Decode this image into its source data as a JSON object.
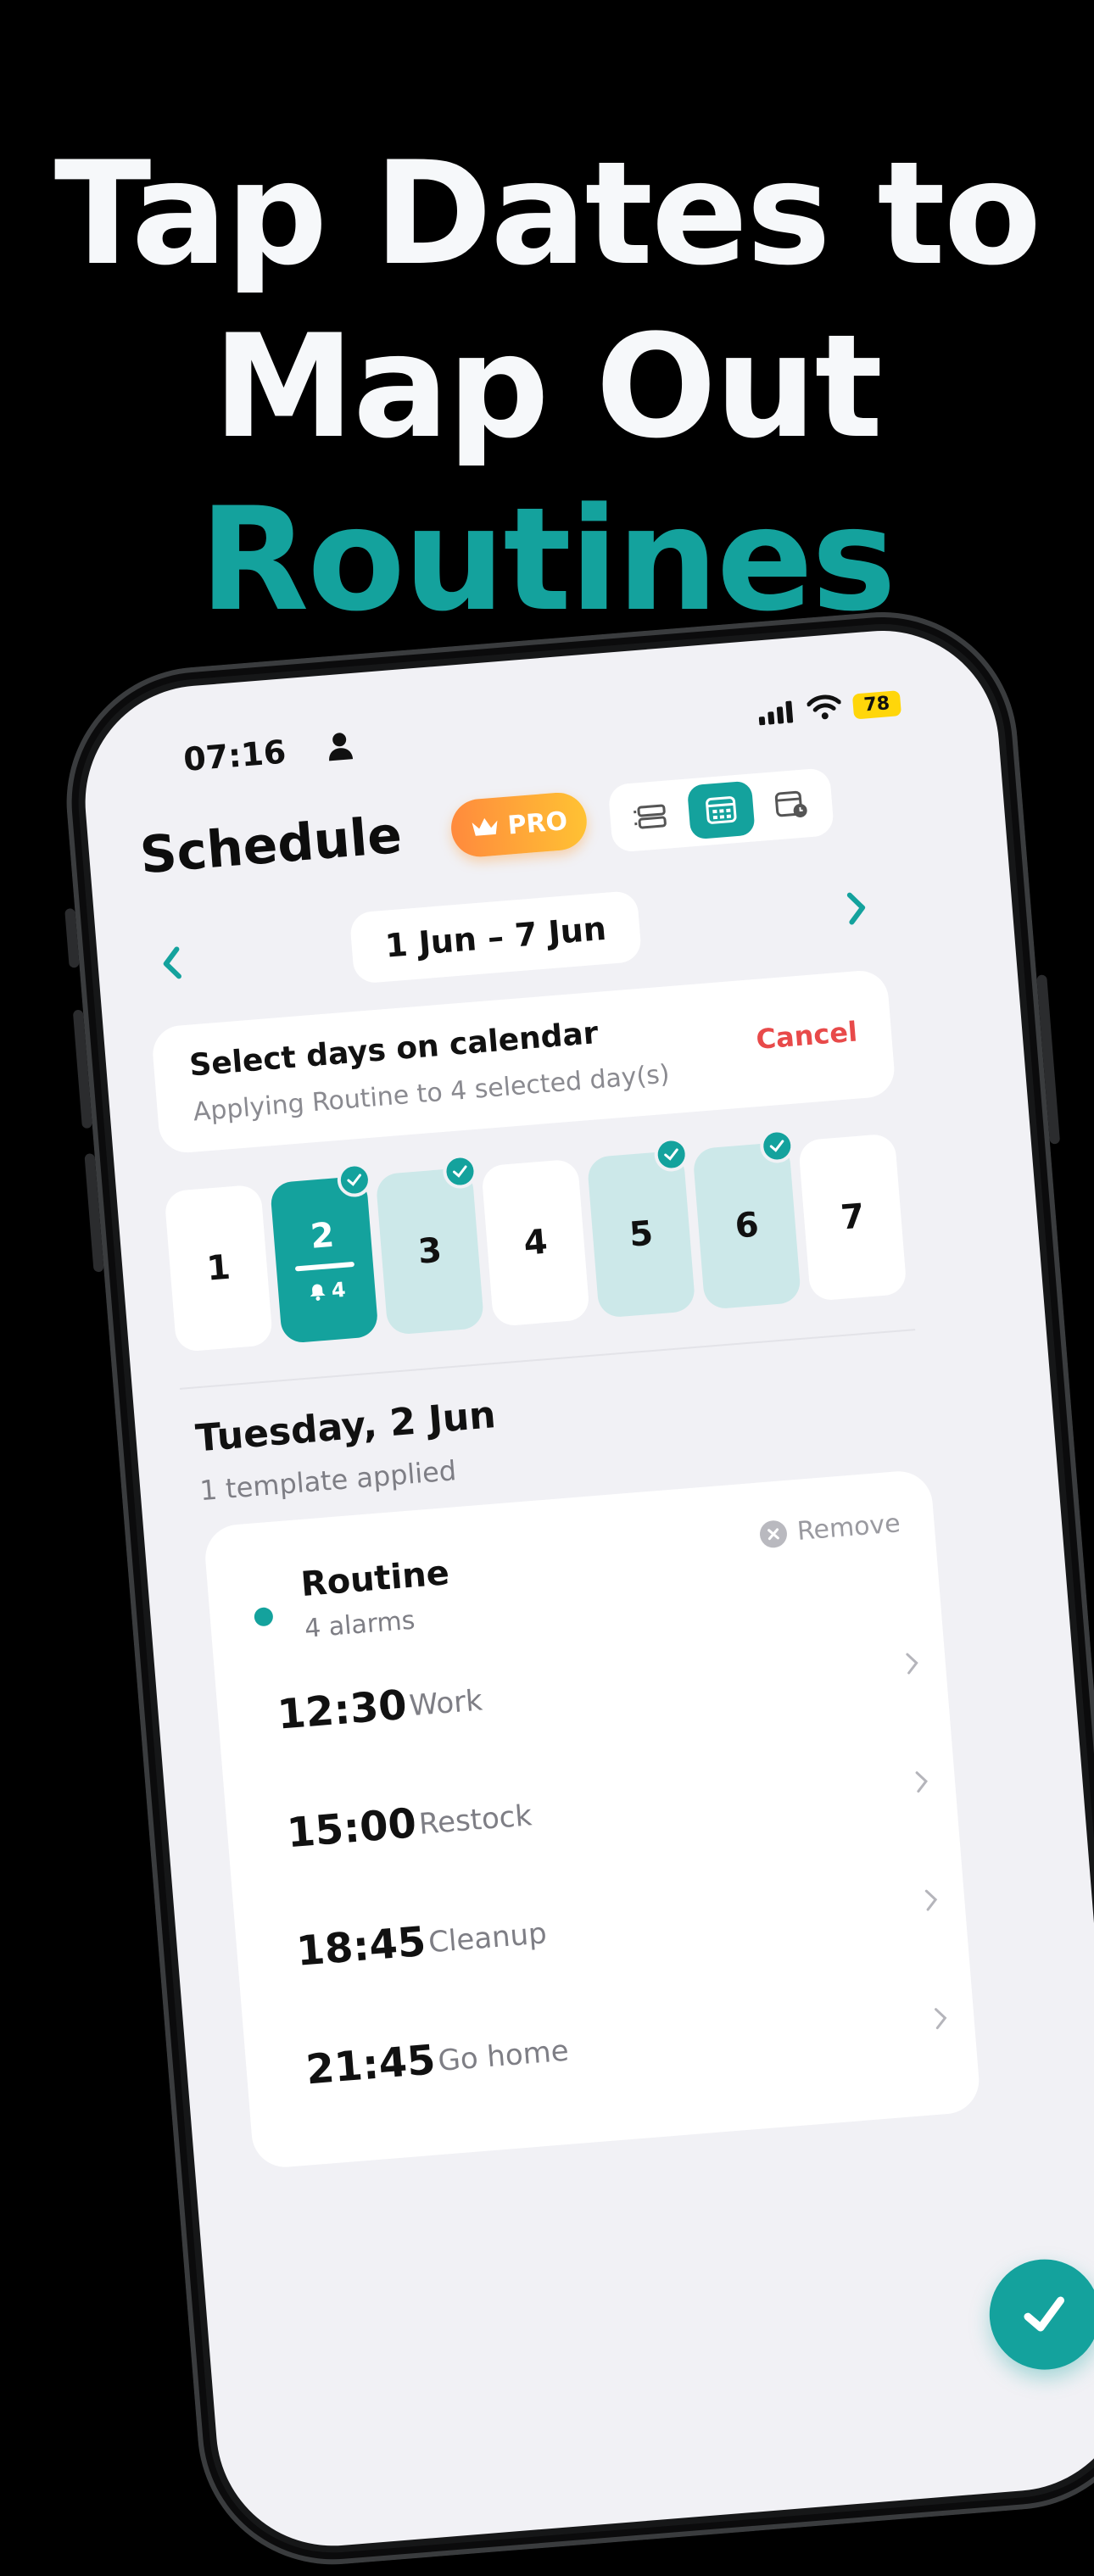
{
  "headline": {
    "line1": "Tap Dates to",
    "line2": "Map Out",
    "line3": "Routines"
  },
  "colors": {
    "accent": "#14a29d",
    "danger": "#e84a4a",
    "pro_gradient_start": "#ff8a3d",
    "pro_gradient_end": "#ffc233"
  },
  "status_bar": {
    "time": "07:16",
    "battery": "78"
  },
  "header": {
    "title": "Schedule",
    "pro_label": "PRO"
  },
  "view_toggle": {
    "options": [
      "list-view-icon",
      "calendar-view-icon",
      "calendar-clock-icon"
    ],
    "active": "calendar-view-icon"
  },
  "week_nav": {
    "range": "1 Jun – 7 Jun"
  },
  "select_banner": {
    "title": "Select days on calendar",
    "subtitle": "Applying Routine to 4 selected day(s)",
    "cancel_label": "Cancel"
  },
  "days": [
    {
      "num": "1",
      "state": "normal"
    },
    {
      "num": "2",
      "state": "today",
      "alarms": "4"
    },
    {
      "num": "3",
      "state": "selected"
    },
    {
      "num": "4",
      "state": "normal"
    },
    {
      "num": "5",
      "state": "selected"
    },
    {
      "num": "6",
      "state": "selected"
    },
    {
      "num": "7",
      "state": "normal"
    }
  ],
  "day_detail": {
    "title": "Tuesday, 2 Jun",
    "subtitle": "1 template applied"
  },
  "routine": {
    "name": "Routine",
    "alarm_count": "4 alarms",
    "remove_label": "Remove",
    "alarms": [
      {
        "time": "12:30",
        "label": "Work"
      },
      {
        "time": "15:00",
        "label": "Restock"
      },
      {
        "time": "18:45",
        "label": "Cleanup"
      },
      {
        "time": "21:45",
        "label": "Go home"
      }
    ]
  }
}
